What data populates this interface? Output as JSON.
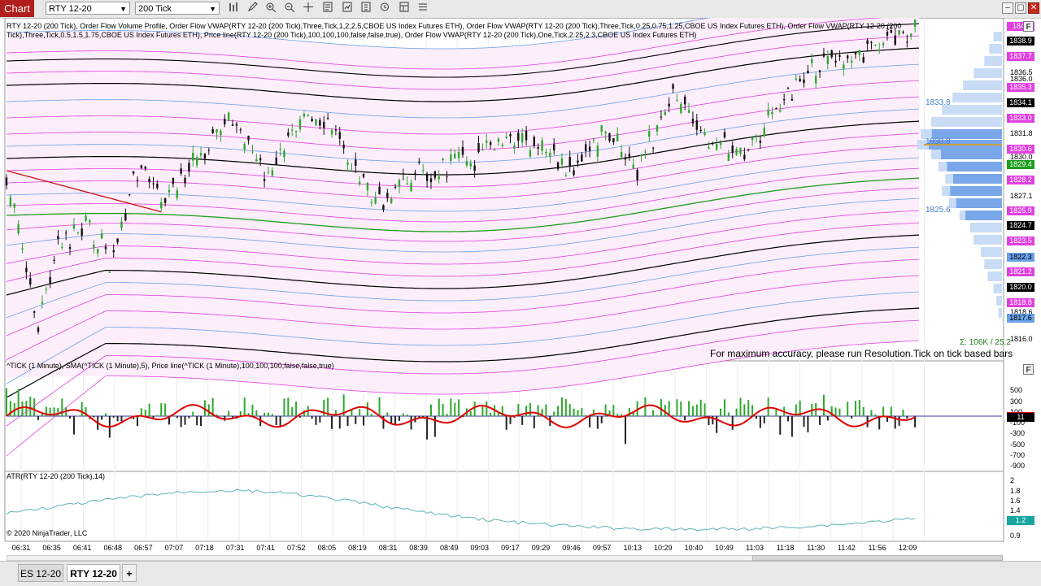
{
  "app": {
    "title": "Chart"
  },
  "toolbar": {
    "instrument": "RTY 12-20",
    "interval": "200 Tick",
    "tools": [
      "bars-icon",
      "draw-pencil-icon",
      "zoom-in-icon",
      "zoom-out-icon",
      "crosshair-icon",
      "properties-icon",
      "strategy-icon",
      "chart-trader-icon",
      "data-box-icon",
      "templates-icon"
    ]
  },
  "window": {
    "buttons": [
      "restore-icon",
      "maximize-icon",
      "close-icon"
    ]
  },
  "main_panel": {
    "header": "RTY 12-20 (200 Tick), Order Flow Volume Profile, Order Flow VWAP(RTY 12-20 (200 Tick),Three,Tick,1,2,2.5,CBOE US Index Futures ETH), Order Flow VWAP(RTY 12-20 (200 Tick),Three,Tick,0.25,0.75,1.25,CBOE US Index Futures ETH), Order Flow VWAP(RTY 12-20 (200 Tick),Three,Tick,0.5,1.5,1.75,CBOE US Index Futures ETH), Price line(RTY 12-20 (200 Tick),100,100,100,false,false,true), Order Flow VWAP(RTY 12-20 (200 Tick),One,Tick,2.25,2.3,CBOE US Index Futures ETH)",
    "volume_sum": "Σ: 106K / 25.2",
    "warning": "For maximum accuracy, please run Resolution.Tick on tick based bars",
    "profile_labels": {
      "upper": "1833.8",
      "mid": "1830.8",
      "lower": "1825.6"
    },
    "price_axis": [
      "1838.9",
      "1837.7",
      "1836.5",
      "1836.0",
      "1835.3",
      "1834.1",
      "1833.0",
      "1831.8",
      "1830.6",
      "1830.0",
      "1829.4",
      "1828.2",
      "1827.1",
      "1825.9",
      "1824.7",
      "1823.5",
      "1822.3",
      "1821.2",
      "1820.0",
      "1818.8",
      "1818.6",
      "1817.6",
      "1816.0"
    ],
    "badges": [
      {
        "text": "1840",
        "bg": "#e040e0",
        "color": "#ffffff"
      },
      {
        "text": "1838.9",
        "bg": "#000000",
        "color": "#ffffff"
      },
      {
        "text": "1837.7",
        "bg": "#e040e0",
        "color": "#ffffff"
      },
      {
        "text": "1835.3",
        "bg": "#e040e0",
        "color": "#ffffff"
      },
      {
        "text": "1834.1",
        "bg": "#000000",
        "color": "#ffffff"
      },
      {
        "text": "1833.0",
        "bg": "#e040e0",
        "color": "#ffffff"
      },
      {
        "text": "1830.6",
        "bg": "#e040e0",
        "color": "#ffffff"
      },
      {
        "text": "1829.4",
        "bg": "#1e9e1e",
        "color": "#ffffff"
      },
      {
        "text": "1828.2",
        "bg": "#e040e0",
        "color": "#ffffff"
      },
      {
        "text": "1825.9",
        "bg": "#e040e0",
        "color": "#ffffff"
      },
      {
        "text": "1824.7",
        "bg": "#000000",
        "color": "#ffffff"
      },
      {
        "text": "1823.5",
        "bg": "#e040e0",
        "color": "#ffffff"
      },
      {
        "text": "1822.3",
        "bg": "#6aa0e8",
        "color": "#000000"
      },
      {
        "text": "1821.2",
        "bg": "#e040e0",
        "color": "#ffffff"
      },
      {
        "text": "1820.0",
        "bg": "#000000",
        "color": "#ffffff"
      },
      {
        "text": "1818.8",
        "bg": "#e040e0",
        "color": "#ffffff"
      },
      {
        "text": "1817.6",
        "bg": "#6aa0e8",
        "color": "#000000"
      }
    ]
  },
  "tick_panel": {
    "header": "^TICK (1 Minute), SMA(^TICK (1 Minute),5), Price line(^TICK (1 Minute),100,100,100,false,false,true)",
    "axis": [
      "500",
      "300",
      "100",
      "-100",
      "-300",
      "-500",
      "-700",
      "-900"
    ],
    "current": "11",
    "current_sma": ""
  },
  "atr_panel": {
    "header": "ATR(RTY 12-20 (200 Tick),14)",
    "axis": [
      "2",
      "1.8",
      "1.6",
      "1.4",
      "1.2",
      "0.9"
    ],
    "current": "1.2",
    "copyright": "© 2020 NinjaTrader, LLC"
  },
  "time_axis": [
    "06:31",
    "06:35",
    "06:41",
    "06:48",
    "06:57",
    "07:07",
    "07:18",
    "07:31",
    "07:41",
    "07:52",
    "08:05",
    "08:19",
    "08:31",
    "08:39",
    "08:49",
    "09:03",
    "09:17",
    "09:29",
    "09:46",
    "09:57",
    "10:13",
    "10:29",
    "10:40",
    "10:49",
    "11:03",
    "11:18",
    "11:30",
    "11:42",
    "11:56",
    "12:09"
  ],
  "tabs": [
    {
      "label": "ES 12-20",
      "active": false
    },
    {
      "label": "RTY 12-20",
      "active": true
    },
    {
      "label": "+",
      "active": false
    }
  ],
  "colors": {
    "up": "#2ea82e",
    "down": "#111111",
    "vwap": "#000000",
    "band_pink": "#e040e0",
    "band_blue": "#6aa0e8",
    "band_green": "#1e9e1e",
    "sma": "#e00000",
    "atr": "#5fb4b4",
    "profile": "#7aa6ea"
  }
}
